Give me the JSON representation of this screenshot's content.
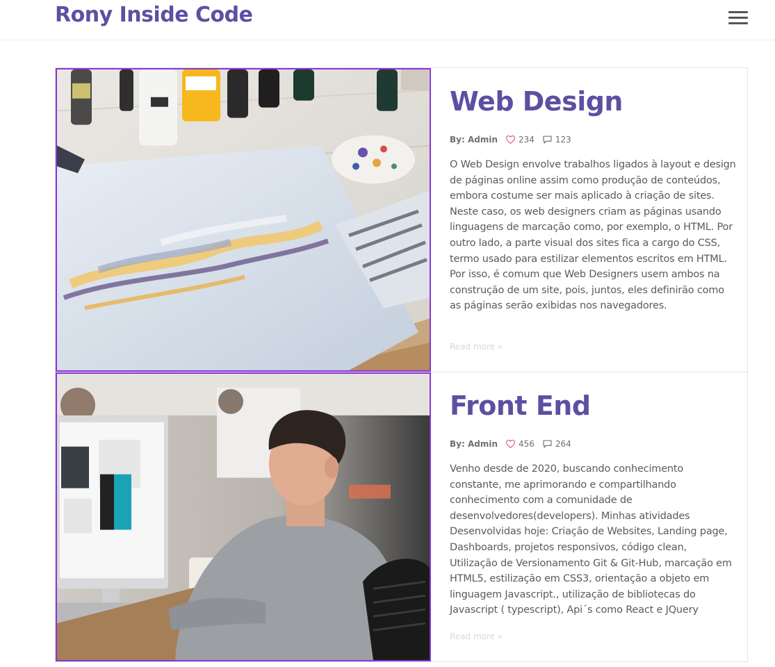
{
  "brand": "Rony Inside Code",
  "posts": [
    {
      "title": "Web Design",
      "author": "By: Admin",
      "likes": "234",
      "comments": "123",
      "text": "O Web Design envolve trabalhos ligados à layout e design de páginas online assim como produção de conteúdos, embora costume ser mais aplicado à criação de sites. Neste caso, os web designers criam as páginas usando linguagens de marcação como, por exemplo, o HTML. Por outro lado, a parte visual dos sites fica a cargo do CSS, termo usado para estilizar elementos escritos em HTML. Por isso, é comum que Web Designers usem ambos na construção de um site, pois, juntos, eles definirão como as páginas serão exibidas nos navegadores.",
      "read_more": "Read more"
    },
    {
      "title": "Front End",
      "author": "By: Admin",
      "likes": "456",
      "comments": "264",
      "text": "Venho desde de 2020, buscando conhecimento constante, me aprimorando e compartilhando conhecimento com a comunidade de desenvolvedores(developers). Minhas atividades Desenvolvidas hoje: Criação de Websites, Landing page, Dashboards, projetos responsivos, código clean, Utilização de Versionamento Git & Git-Hub, marcação em HTML5, estilização em CSS3, orientação a objeto em linguagem Javascript., utilização de bibliotecas do Javascript ( typescript), Api´s como React e JQuery",
      "read_more": "Read more"
    }
  ],
  "colors": {
    "brand": "#5e4fa2",
    "image_border": "#8a35d6",
    "heart": "#e0557f"
  },
  "icons": {
    "menu": "hamburger-icon",
    "likes": "heart-icon",
    "comments": "comment-icon",
    "read_more": "double-chevron-right-icon"
  }
}
